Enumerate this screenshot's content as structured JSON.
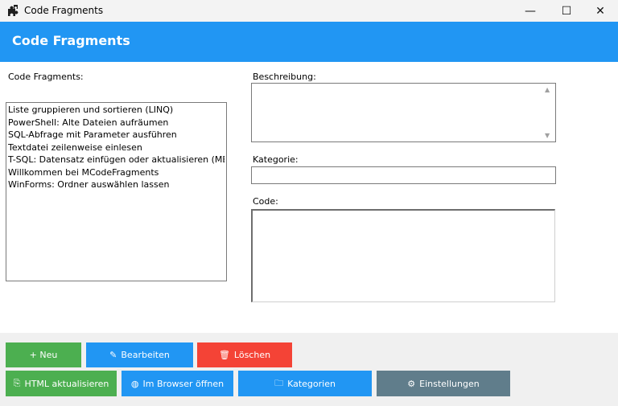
{
  "window": {
    "title": "Code Fragments",
    "minimize": "—",
    "maximize": "☐",
    "close": "✕"
  },
  "header": {
    "title": "Code Fragments"
  },
  "left": {
    "label": "Code Fragments:",
    "items": [
      "Liste gruppieren und sortieren (LINQ)",
      "PowerShell: Alte Dateien aufräumen",
      "SQL-Abfrage mit Parameter ausführen",
      "Textdatei zeilenweise einlesen",
      "T-SQL: Datensatz einfügen oder aktualisieren (MERGE)",
      "Willkommen bei MCodeFragments",
      "WinForms: Ordner auswählen lassen"
    ]
  },
  "right": {
    "description_label": "Beschreibung:",
    "description_value": "",
    "category_label": "Kategorie:",
    "category_value": "",
    "code_label": "Code:",
    "code_value": ""
  },
  "buttons": {
    "new": "+ Neu",
    "edit": "Bearbeiten",
    "delete": "Löschen",
    "html_update": "HTML aktualisieren",
    "open_browser": "Im Browser öffnen",
    "categories": "Kategorien",
    "settings": "Einstellungen"
  },
  "icons": {
    "edit": "✎",
    "delete": "🗑",
    "html_update": "⎘",
    "open_browser": "◍",
    "categories": "🗀",
    "settings": "⚙"
  },
  "colors": {
    "header": "#2196f3",
    "new": "#4caf50",
    "edit": "#2196f3",
    "delete": "#f44336",
    "html_update": "#4caf50",
    "open_browser": "#2196f3",
    "categories": "#2196f3",
    "settings": "#607d8b"
  }
}
